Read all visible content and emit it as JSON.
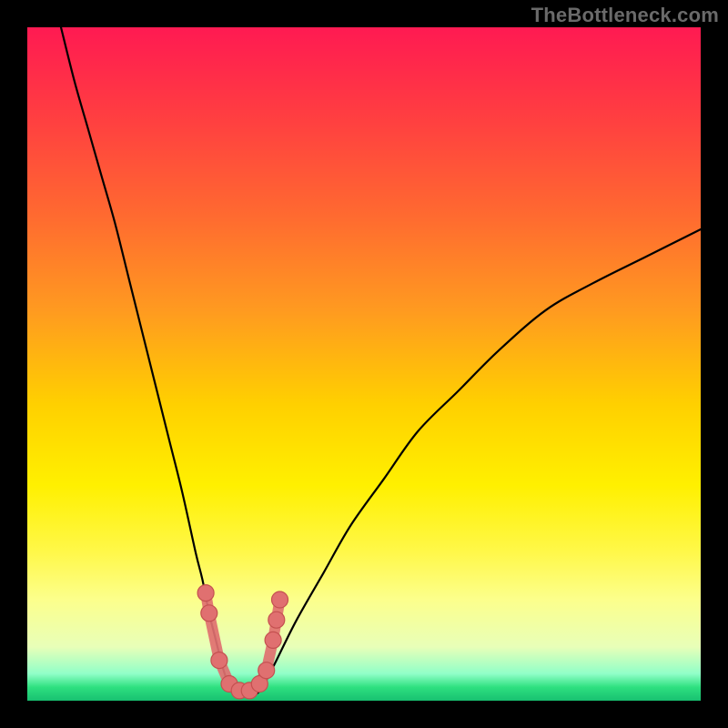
{
  "attribution": "TheBottleneck.com",
  "chart_data": {
    "type": "line",
    "title": "",
    "xlabel": "",
    "ylabel": "",
    "ylim": [
      0,
      100
    ],
    "xlim": [
      0,
      100
    ],
    "legend": false,
    "grid": false,
    "description": "Bottleneck percentage curve. Two monotone branches meeting near a minimum around x≈30 where bottleneck ≈ 0–4%. Left branch descends steeply from near 100% at x≈5; right branch rises toward ~70% at x≈100.",
    "series": [
      {
        "name": "left-branch",
        "x": [
          5,
          7,
          9,
          11,
          13,
          15,
          17,
          19,
          21,
          23,
          25,
          26,
          27,
          28,
          29,
          30
        ],
        "values": [
          100,
          92,
          85,
          78,
          71,
          63,
          55,
          47,
          39,
          31,
          22,
          18,
          13,
          9,
          5,
          2
        ]
      },
      {
        "name": "valley",
        "x": [
          30,
          31,
          32,
          33,
          34,
          35
        ],
        "values": [
          2,
          1,
          1,
          1,
          1,
          2
        ]
      },
      {
        "name": "right-branch",
        "x": [
          35,
          37,
          40,
          44,
          48,
          53,
          58,
          64,
          70,
          77,
          84,
          92,
          100
        ],
        "values": [
          2,
          6,
          12,
          19,
          26,
          33,
          40,
          46,
          52,
          58,
          62,
          66,
          70
        ]
      }
    ],
    "markers": {
      "name": "highlighted-points",
      "color": "#e07070",
      "points": [
        {
          "x": 26.5,
          "y": 16
        },
        {
          "x": 27.0,
          "y": 13
        },
        {
          "x": 28.5,
          "y": 6
        },
        {
          "x": 30.0,
          "y": 2.5
        },
        {
          "x": 31.5,
          "y": 1.5
        },
        {
          "x": 33.0,
          "y": 1.5
        },
        {
          "x": 34.5,
          "y": 2.5
        },
        {
          "x": 35.5,
          "y": 4.5
        },
        {
          "x": 36.5,
          "y": 9
        },
        {
          "x": 37.0,
          "y": 12
        },
        {
          "x": 37.5,
          "y": 15
        }
      ]
    },
    "background_gradient_stops": [
      {
        "pct": 0,
        "color": "#ff1a52"
      },
      {
        "pct": 14,
        "color": "#ff4040"
      },
      {
        "pct": 42,
        "color": "#ff9a20"
      },
      {
        "pct": 68,
        "color": "#fff000"
      },
      {
        "pct": 92,
        "color": "#e8ffb8"
      },
      {
        "pct": 100,
        "color": "#18c070"
      }
    ]
  }
}
